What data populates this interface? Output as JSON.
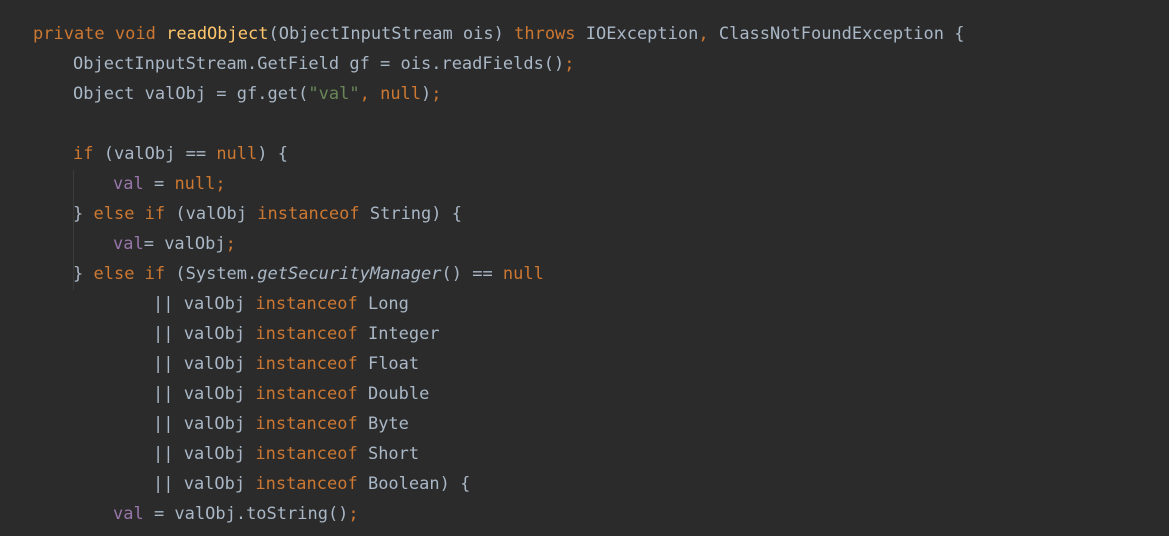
{
  "editor": {
    "lines": [
      {
        "indent": 0,
        "tokens": [
          {
            "t": "private",
            "c": "kw"
          },
          {
            "t": " ",
            "c": "plain"
          },
          {
            "t": "void",
            "c": "kw"
          },
          {
            "t": " ",
            "c": "plain"
          },
          {
            "t": "readObject",
            "c": "fn"
          },
          {
            "t": "(ObjectInputStream ois) ",
            "c": "plain"
          },
          {
            "t": "throws",
            "c": "kw"
          },
          {
            "t": " IOException",
            "c": "plain"
          },
          {
            "t": ", ",
            "c": "punct"
          },
          {
            "t": "ClassNotFoundException {",
            "c": "plain"
          }
        ]
      },
      {
        "indent": 1,
        "tokens": [
          {
            "t": "ObjectInputStream.GetField gf = ois.readFields()",
            "c": "plain"
          },
          {
            "t": ";",
            "c": "punct"
          }
        ]
      },
      {
        "indent": 1,
        "tokens": [
          {
            "t": "Object valObj = gf.get(",
            "c": "plain"
          },
          {
            "t": "\"val\"",
            "c": "str"
          },
          {
            "t": ", ",
            "c": "punct"
          },
          {
            "t": "null",
            "c": "kw"
          },
          {
            "t": ")",
            "c": "plain"
          },
          {
            "t": ";",
            "c": "punct"
          }
        ]
      },
      {
        "indent": 0,
        "tokens": []
      },
      {
        "indent": 1,
        "tokens": [
          {
            "t": "if",
            "c": "kw"
          },
          {
            "t": " (valObj == ",
            "c": "plain"
          },
          {
            "t": "null",
            "c": "kw"
          },
          {
            "t": ") {",
            "c": "plain"
          }
        ]
      },
      {
        "indent": 2,
        "tokens": [
          {
            "t": "val",
            "c": "field"
          },
          {
            "t": " = ",
            "c": "plain"
          },
          {
            "t": "null",
            "c": "kw"
          },
          {
            "t": ";",
            "c": "punct"
          }
        ]
      },
      {
        "indent": 1,
        "tokens": [
          {
            "t": "} ",
            "c": "plain"
          },
          {
            "t": "else if",
            "c": "kw"
          },
          {
            "t": " (valObj ",
            "c": "plain"
          },
          {
            "t": "instanceof",
            "c": "kw"
          },
          {
            "t": " String) {",
            "c": "plain"
          }
        ]
      },
      {
        "indent": 2,
        "tokens": [
          {
            "t": "val",
            "c": "field"
          },
          {
            "t": "= valObj",
            "c": "plain"
          },
          {
            "t": ";",
            "c": "punct"
          }
        ]
      },
      {
        "indent": 1,
        "tokens": [
          {
            "t": "} ",
            "c": "plain"
          },
          {
            "t": "else if",
            "c": "kw"
          },
          {
            "t": " (System.",
            "c": "plain"
          },
          {
            "t": "getSecurityManager",
            "c": "italic"
          },
          {
            "t": "() == ",
            "c": "plain"
          },
          {
            "t": "null",
            "c": "kw"
          }
        ]
      },
      {
        "indent": 3,
        "tokens": [
          {
            "t": "|| valObj ",
            "c": "plain"
          },
          {
            "t": "instanceof",
            "c": "kw"
          },
          {
            "t": " Long",
            "c": "plain"
          }
        ]
      },
      {
        "indent": 3,
        "tokens": [
          {
            "t": "|| valObj ",
            "c": "plain"
          },
          {
            "t": "instanceof",
            "c": "kw"
          },
          {
            "t": " Integer",
            "c": "plain"
          }
        ]
      },
      {
        "indent": 3,
        "tokens": [
          {
            "t": "|| valObj ",
            "c": "plain"
          },
          {
            "t": "instanceof",
            "c": "kw"
          },
          {
            "t": " Float",
            "c": "plain"
          }
        ]
      },
      {
        "indent": 3,
        "tokens": [
          {
            "t": "|| valObj ",
            "c": "plain"
          },
          {
            "t": "instanceof",
            "c": "kw"
          },
          {
            "t": " Double",
            "c": "plain"
          }
        ]
      },
      {
        "indent": 3,
        "tokens": [
          {
            "t": "|| valObj ",
            "c": "plain"
          },
          {
            "t": "instanceof",
            "c": "kw"
          },
          {
            "t": " Byte",
            "c": "plain"
          }
        ]
      },
      {
        "indent": 3,
        "tokens": [
          {
            "t": "|| valObj ",
            "c": "plain"
          },
          {
            "t": "instanceof",
            "c": "kw"
          },
          {
            "t": " Short",
            "c": "plain"
          }
        ]
      },
      {
        "indent": 3,
        "tokens": [
          {
            "t": "|| valObj ",
            "c": "plain"
          },
          {
            "t": "instanceof",
            "c": "kw"
          },
          {
            "t": " Boolean) {",
            "c": "plain"
          }
        ]
      },
      {
        "indent": 2,
        "tokens": [
          {
            "t": "val",
            "c": "field"
          },
          {
            "t": " = valObj.toString()",
            "c": "plain"
          },
          {
            "t": ";",
            "c": "punct"
          }
        ]
      }
    ]
  }
}
